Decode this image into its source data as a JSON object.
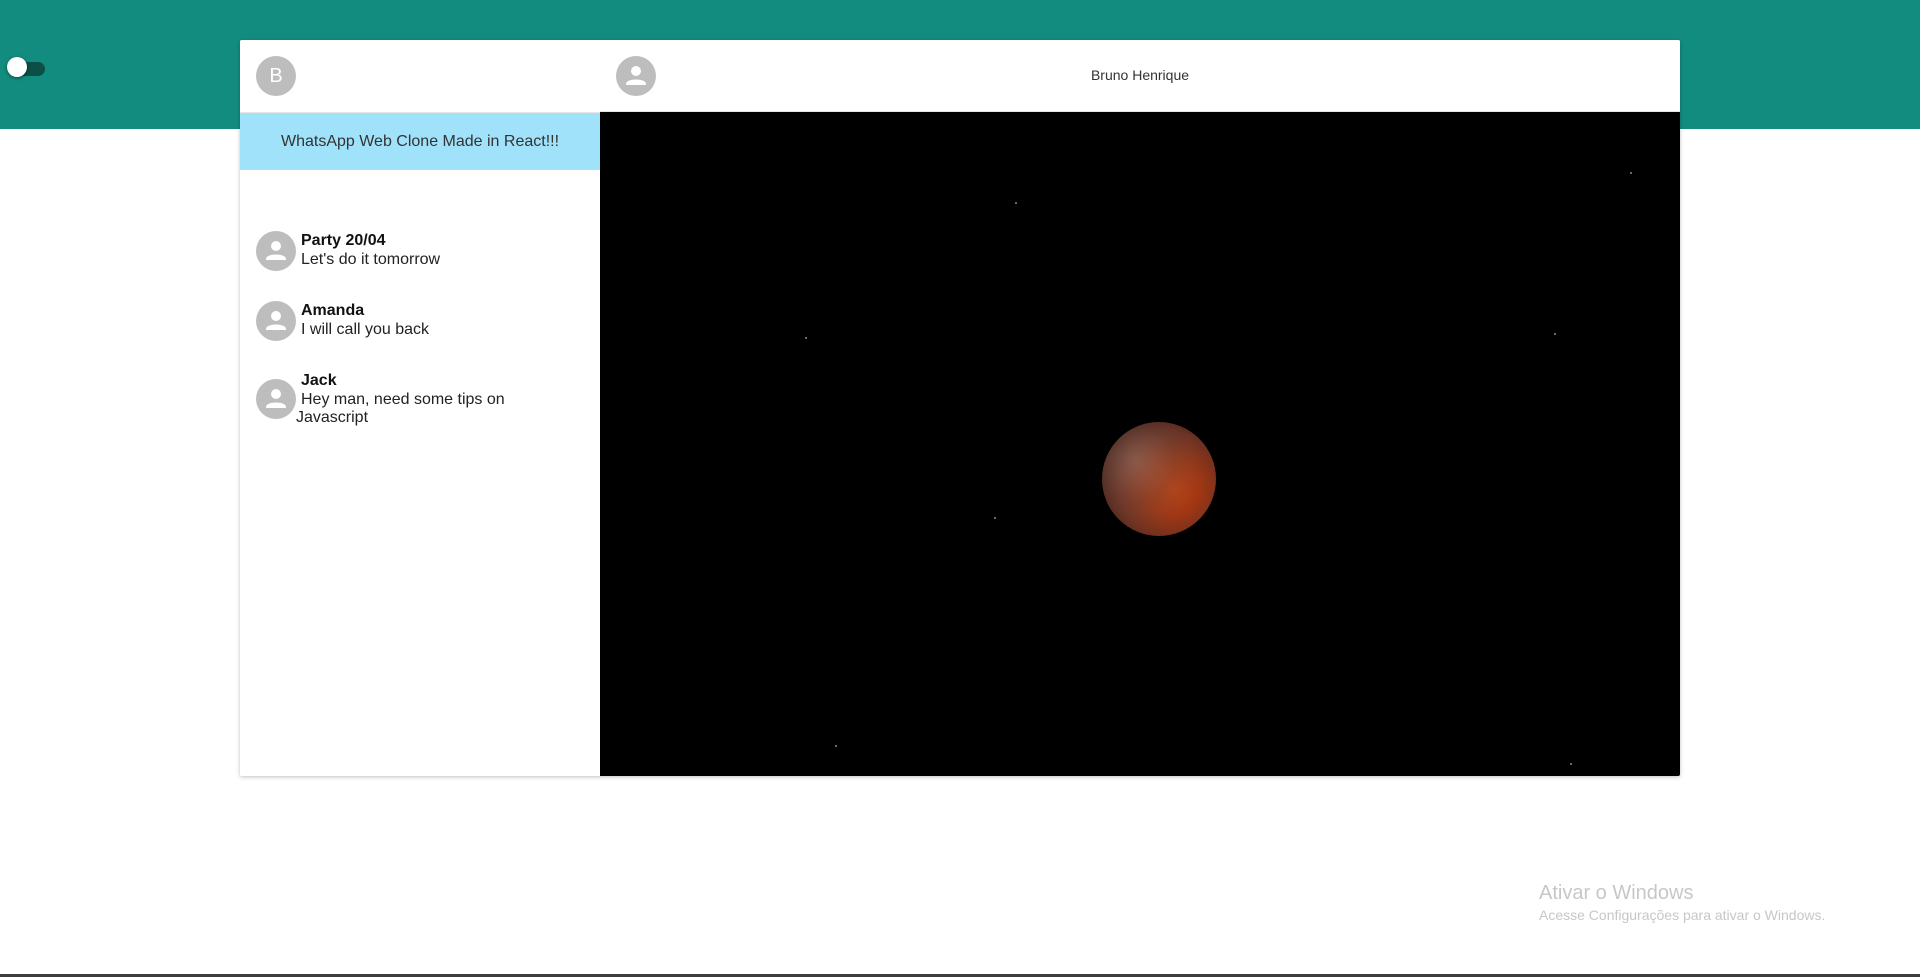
{
  "theme_toggle": {
    "state": "off"
  },
  "sidebar": {
    "user_initial": "B",
    "banner_text": "WhatsApp Web Clone Made in React!!!",
    "chats": [
      {
        "name": "Party 20/04",
        "last_message": "Let's do it tomorrow"
      },
      {
        "name": "Amanda",
        "last_message": "I will call you back"
      },
      {
        "name": "Jack",
        "last_message_line1": "Hey man, need some tips on",
        "last_message_line2": "Javascript"
      }
    ]
  },
  "chat": {
    "contact_name": "Bruno Henrique",
    "background": "dark night sky with a red lunar eclipse"
  },
  "watermark": {
    "title": "Ativar o Windows",
    "subtitle": "Acesse Configurações para ativar o Windows."
  },
  "colors": {
    "header_green": "#128c7e",
    "banner_blue": "#a0e2fa",
    "avatar_gray": "#bdbdbd"
  },
  "icons": [
    "person-icon"
  ]
}
